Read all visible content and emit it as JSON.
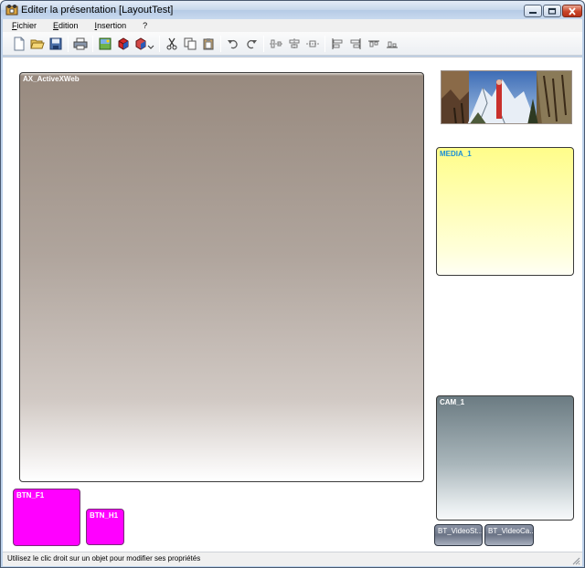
{
  "window": {
    "title": "Editer la présentation  [LayoutTest]"
  },
  "menu": {
    "items": [
      {
        "underline": "F",
        "rest": "ichier"
      },
      {
        "underline": "E",
        "rest": "dition"
      },
      {
        "underline": "I",
        "rest": "nsertion"
      },
      {
        "underline": "",
        "rest": "?"
      }
    ]
  },
  "toolbar": {
    "buttons": [
      "new-document-icon",
      "open-folder-icon",
      "save-icon",
      "print-icon",
      "insert-image-icon",
      "insert-object-icon",
      "insert-dropdown-icon",
      "cut-icon",
      "copy-icon",
      "paste-icon",
      "undo-icon",
      "redo-icon",
      "align-horizontal-icon",
      "align-center-icon",
      "distribute-icon",
      "align-left-icon",
      "align-right-icon",
      "align-top-icon",
      "align-bottom-icon"
    ]
  },
  "canvas": {
    "objects": {
      "ax": {
        "label": "AX_ActiveXWeb"
      },
      "media": {
        "label": "MEDIA_1"
      },
      "cam": {
        "label": "CAM_1"
      },
      "btn_f1": {
        "label": "BTN_F1"
      },
      "btn_h1": {
        "label": "BTN_H1"
      },
      "bt_video_st": {
        "label": "BT_VideoSt..."
      },
      "bt_video_ca": {
        "label": "BT_VideoCa..."
      }
    }
  },
  "statusbar": {
    "text": "Utilisez le clic droit sur un objet pour modifier ses propriétés"
  },
  "colors": {
    "title_gradient": "#c5d6eb",
    "magenta_button": "#ff00ff",
    "media_yellow": "#fffd8a",
    "media_label": "#1a8fd6",
    "cam_top": "#6b7b82",
    "ax_top": "#988a7f"
  }
}
